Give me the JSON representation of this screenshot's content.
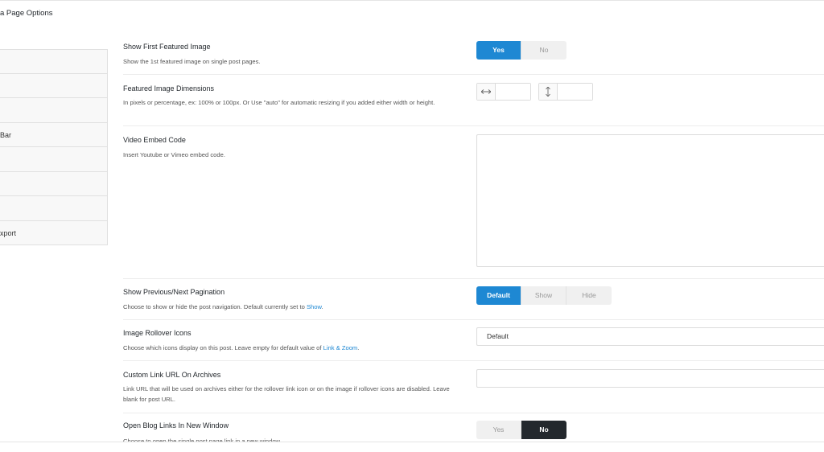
{
  "panel": {
    "title": "a Page Options"
  },
  "sidebar": {
    "items": [
      {
        "label": ""
      },
      {
        "label": ""
      },
      {
        "label": ""
      },
      {
        "label": "Bar"
      },
      {
        "label": ""
      },
      {
        "label": ""
      },
      {
        "label": ""
      },
      {
        "label": "xport"
      }
    ]
  },
  "options": {
    "featured_image": {
      "label": "Show First Featured Image",
      "desc": "Show the 1st featured image on single post pages.",
      "buttons": [
        "Yes",
        "No"
      ],
      "selected": "Yes"
    },
    "dimensions": {
      "label": "Featured Image Dimensions",
      "desc": "In pixels or percentage, ex: 100% or 100px. Or Use \"auto\" for automatic resizing if you added either width or height.",
      "width_value": "",
      "height_value": ""
    },
    "video": {
      "label": "Video Embed Code",
      "desc": "Insert Youtube or Vimeo embed code.",
      "value": ""
    },
    "pagination": {
      "label": "Show Previous/Next Pagination",
      "desc_before": "Choose to show or hide the post navigation. Default currently set to ",
      "desc_link": "Show",
      "desc_after": ".",
      "buttons": [
        "Default",
        "Show",
        "Hide"
      ],
      "selected": "Default"
    },
    "rollover": {
      "label": "Image Rollover Icons",
      "desc_before": "Choose which icons display on this post. Leave empty for default value of ",
      "desc_link": "Link & Zoom",
      "desc_after": ".",
      "selected_value": "Default"
    },
    "custom_link": {
      "label": "Custom Link URL On Archives",
      "desc": "Link URL that will be used on archives either for the rollover link icon or on the image if rollover icons are disabled. Leave blank for post URL.",
      "value": ""
    },
    "new_window": {
      "label": "Open Blog Links In New Window",
      "desc": "Choose to open the single post page link in a new window.",
      "buttons": [
        "Yes",
        "No"
      ],
      "selected": "No"
    }
  },
  "colors": {
    "accent_blue": "#1e88d3",
    "active_dark": "#23282d"
  },
  "icons": {
    "width": "horizontal-arrows-icon",
    "height": "vertical-arrows-icon"
  }
}
